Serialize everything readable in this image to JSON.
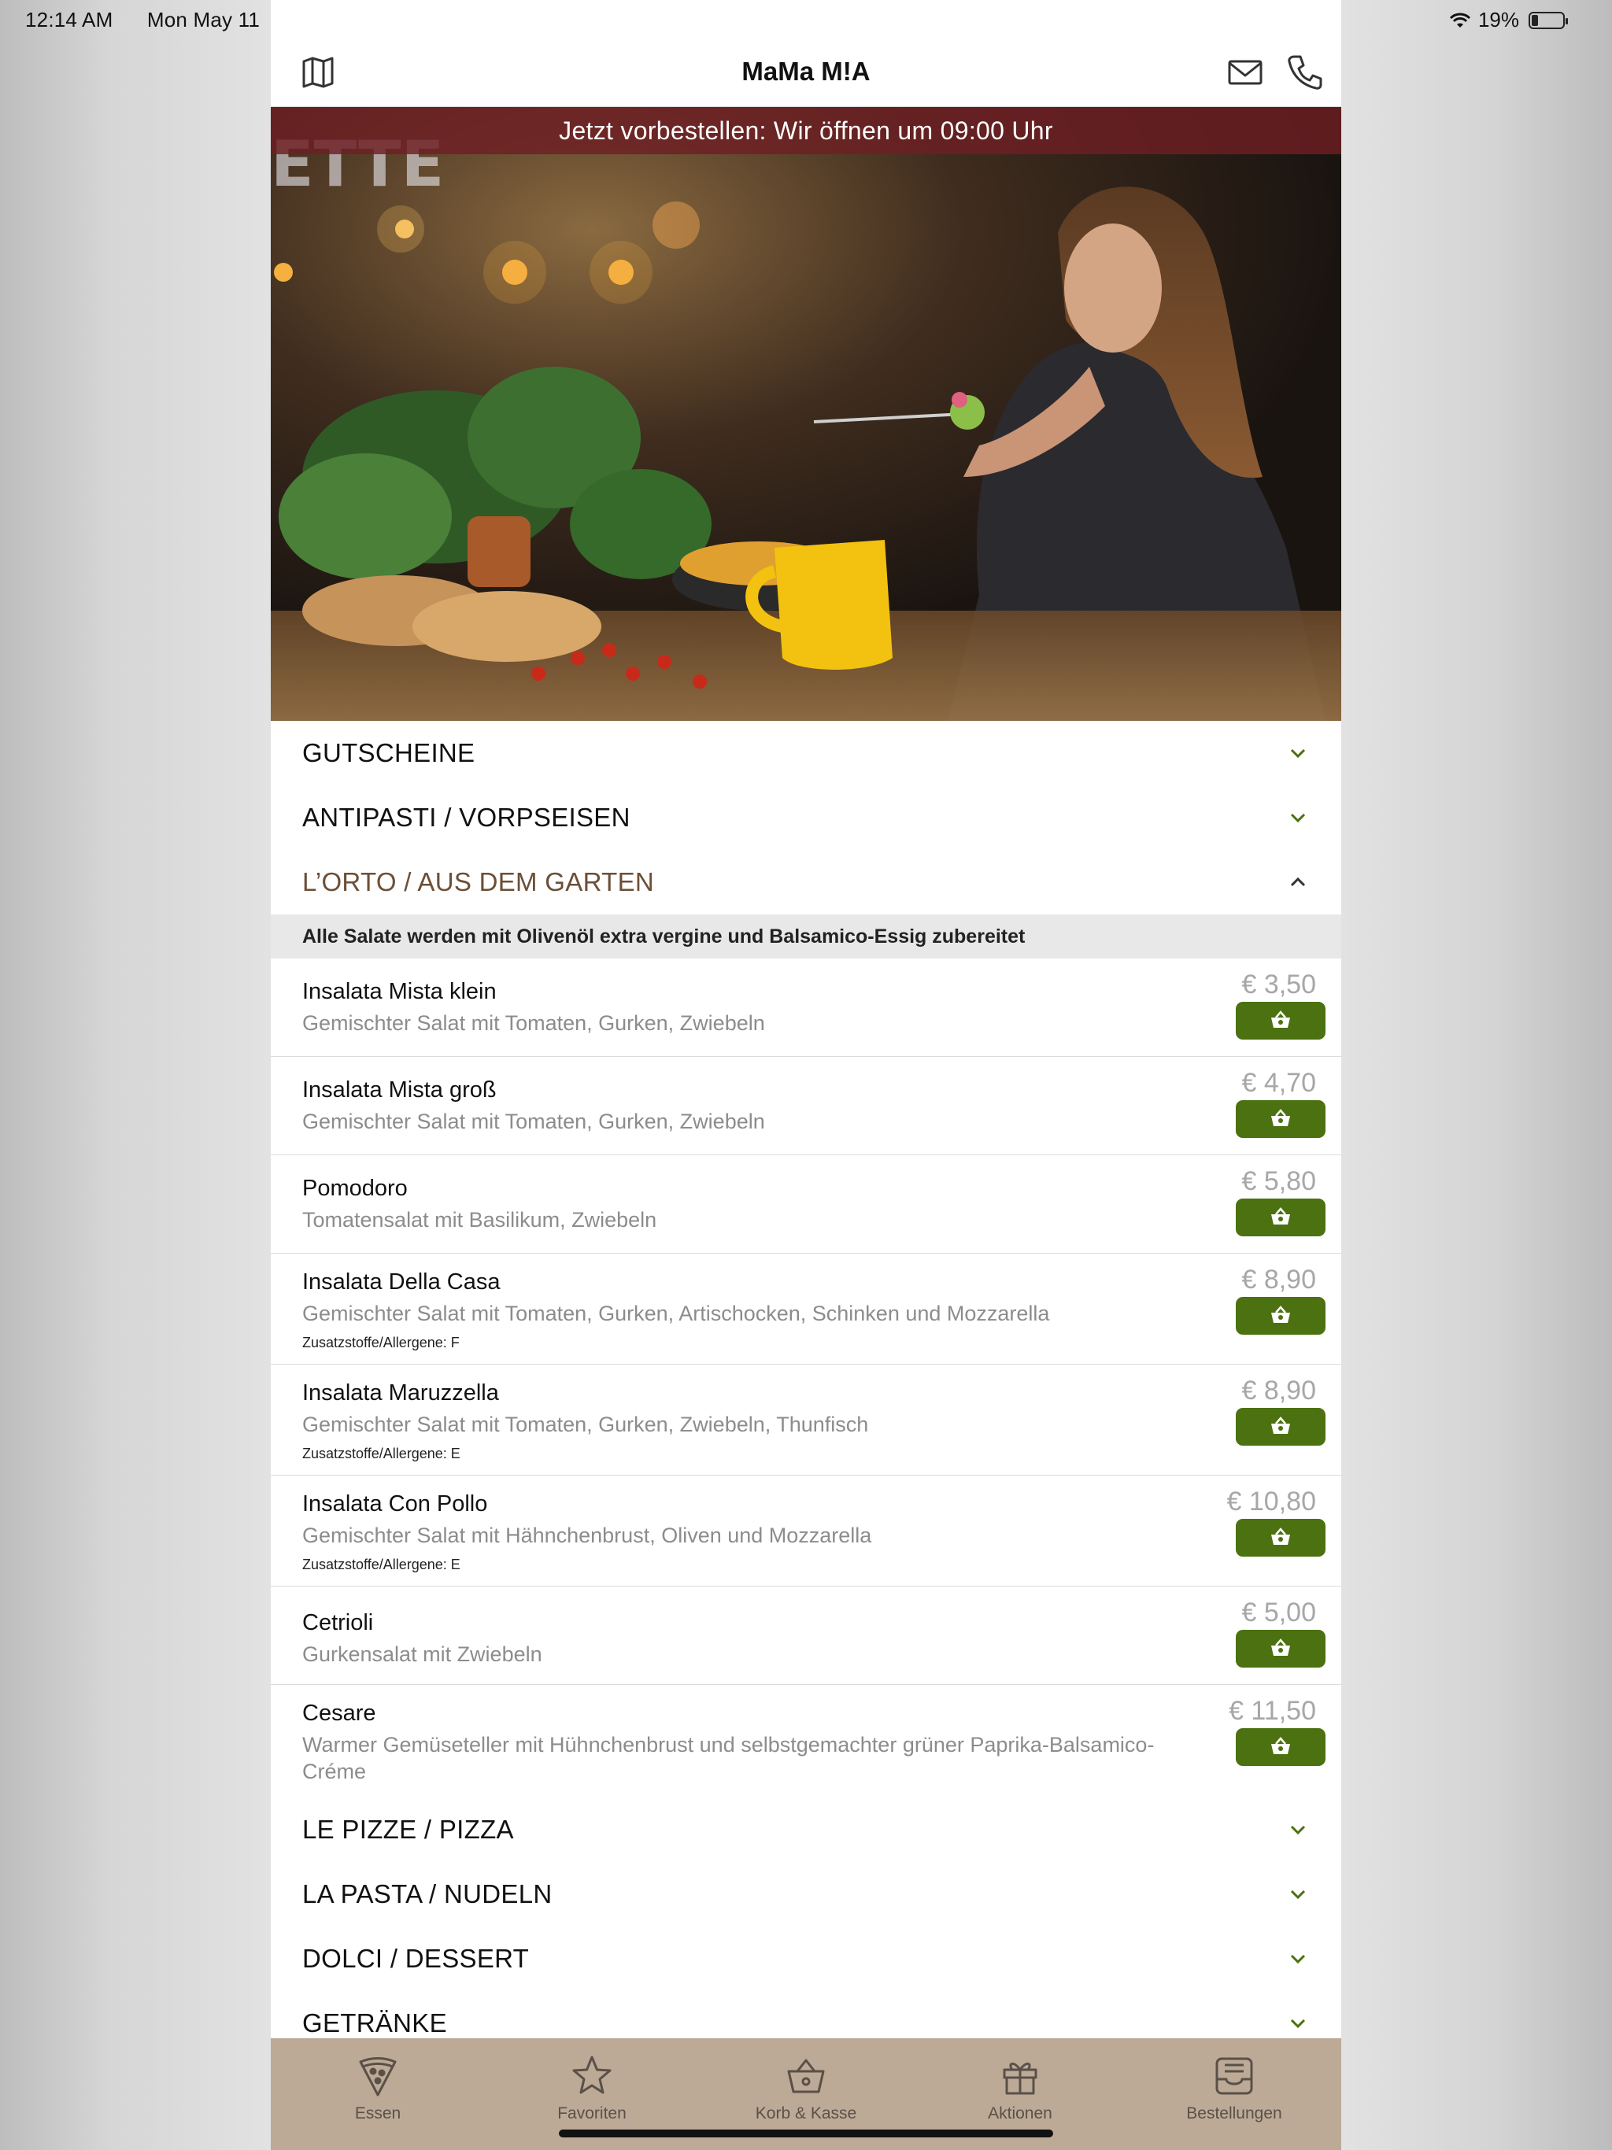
{
  "status_bar": {
    "time": "12:14 AM",
    "date": "Mon May 11",
    "battery": "19%"
  },
  "header": {
    "title": "MaMa M!A",
    "left_icon": "map-icon",
    "right_icons": [
      "mail-icon",
      "phone-icon"
    ]
  },
  "banner": "Jetzt vorbestellen: Wir öffnen um 09:00 Uhr",
  "sections_top": [
    {
      "label": "GUTSCHEINE",
      "expanded": false
    },
    {
      "label": "ANTIPASTI / VORPSEISEN",
      "expanded": false
    },
    {
      "label": "L’ORTO / AUS DEM GARTEN",
      "expanded": true
    }
  ],
  "category_note": "Alle Salate werden mit Olivenöl extra vergine und Balsamico-Essig zubereitet",
  "items": [
    {
      "name": "Insalata Mista klein",
      "desc": "Gemischter Salat mit Tomaten, Gurken, Zwiebeln",
      "allergens": "",
      "price": "€ 3,50"
    },
    {
      "name": "Insalata Mista groß",
      "desc": "Gemischter Salat mit Tomaten, Gurken, Zwiebeln",
      "allergens": "",
      "price": "€ 4,70"
    },
    {
      "name": "Pomodoro",
      "desc": "Tomatensalat mit Basilikum, Zwiebeln",
      "allergens": "",
      "price": "€ 5,80"
    },
    {
      "name": "Insalata Della Casa",
      "desc": "Gemischter Salat mit Tomaten, Gurken, Artischocken, Schinken und Mozzarella",
      "allergens": "Zusatzstoffe/Allergene: F",
      "price": "€ 8,90"
    },
    {
      "name": "Insalata Maruzzella",
      "desc": "Gemischter Salat mit Tomaten, Gurken, Zwiebeln, Thunfisch",
      "allergens": "Zusatzstoffe/Allergene: E",
      "price": "€ 8,90"
    },
    {
      "name": "Insalata Con Pollo",
      "desc": "Gemischter Salat mit Hähnchenbrust, Oliven und Mozzarella",
      "allergens": "Zusatzstoffe/Allergene: E",
      "price": "€ 10,80"
    },
    {
      "name": "Cetrioli",
      "desc": "Gurkensalat mit Zwiebeln",
      "allergens": "",
      "price": "€ 5,00"
    },
    {
      "name": "Cesare",
      "desc": "Warmer Gemüseteller mit Hühnchenbrust und selbstgemachter grüner Paprika-Balsamico-Créme",
      "allergens": "",
      "price": "€ 11,50"
    }
  ],
  "sections_bottom": [
    {
      "label": "LE PIZZE / PIZZA",
      "expanded": false
    },
    {
      "label": "LA PASTA / NUDELN",
      "expanded": false
    },
    {
      "label": "DOLCI / DESSERT",
      "expanded": false
    },
    {
      "label": "GETRÄNKE",
      "expanded": false
    }
  ],
  "tabs": [
    {
      "label": "Essen",
      "icon": "pizza-icon"
    },
    {
      "label": "Favoriten",
      "icon": "star-icon"
    },
    {
      "label": "Korb & Kasse",
      "icon": "basket-icon"
    },
    {
      "label": "Aktionen",
      "icon": "gift-icon"
    },
    {
      "label": "Bestellungen",
      "icon": "tray-icon"
    }
  ],
  "colors": {
    "accent_green": "#4b7110",
    "banner": "#6e1e23",
    "tabbar": "#bcaa97",
    "open_section": "#6b4f36"
  }
}
